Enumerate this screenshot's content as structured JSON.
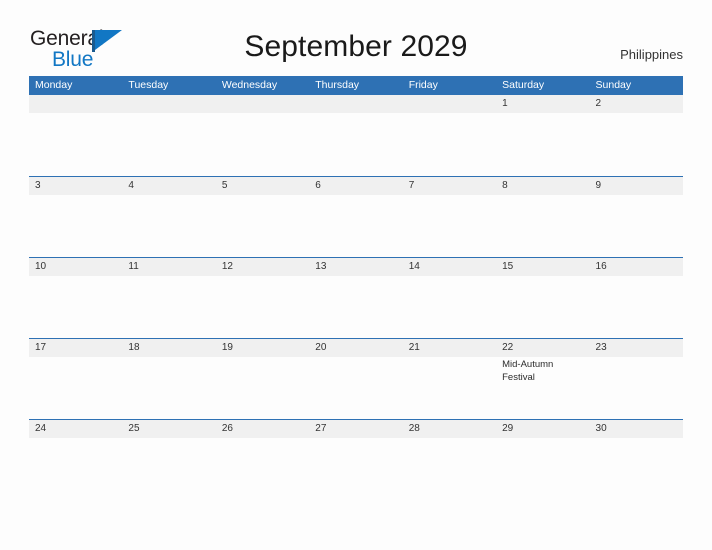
{
  "brand": {
    "name_part1": "General",
    "name_part2": "Blue",
    "flag_icon": "flag-icon",
    "primary_color": "#1277c4",
    "header_color": "#2e71b4"
  },
  "header": {
    "title": "September 2029",
    "country": "Philippines"
  },
  "calendar": {
    "weekdays": [
      "Monday",
      "Tuesday",
      "Wednesday",
      "Thursday",
      "Friday",
      "Saturday",
      "Sunday"
    ],
    "weeks": [
      {
        "days": [
          {
            "num": "",
            "events": []
          },
          {
            "num": "",
            "events": []
          },
          {
            "num": "",
            "events": []
          },
          {
            "num": "",
            "events": []
          },
          {
            "num": "",
            "events": []
          },
          {
            "num": "1",
            "events": []
          },
          {
            "num": "2",
            "events": []
          }
        ]
      },
      {
        "days": [
          {
            "num": "3",
            "events": []
          },
          {
            "num": "4",
            "events": []
          },
          {
            "num": "5",
            "events": []
          },
          {
            "num": "6",
            "events": []
          },
          {
            "num": "7",
            "events": []
          },
          {
            "num": "8",
            "events": []
          },
          {
            "num": "9",
            "events": []
          }
        ]
      },
      {
        "days": [
          {
            "num": "10",
            "events": []
          },
          {
            "num": "11",
            "events": []
          },
          {
            "num": "12",
            "events": []
          },
          {
            "num": "13",
            "events": []
          },
          {
            "num": "14",
            "events": []
          },
          {
            "num": "15",
            "events": []
          },
          {
            "num": "16",
            "events": []
          }
        ]
      },
      {
        "days": [
          {
            "num": "17",
            "events": []
          },
          {
            "num": "18",
            "events": []
          },
          {
            "num": "19",
            "events": []
          },
          {
            "num": "20",
            "events": []
          },
          {
            "num": "21",
            "events": []
          },
          {
            "num": "22",
            "events": [
              "Mid-Autumn Festival"
            ]
          },
          {
            "num": "23",
            "events": []
          }
        ]
      },
      {
        "days": [
          {
            "num": "24",
            "events": []
          },
          {
            "num": "25",
            "events": []
          },
          {
            "num": "26",
            "events": []
          },
          {
            "num": "27",
            "events": []
          },
          {
            "num": "28",
            "events": []
          },
          {
            "num": "29",
            "events": []
          },
          {
            "num": "30",
            "events": []
          }
        ]
      }
    ]
  }
}
